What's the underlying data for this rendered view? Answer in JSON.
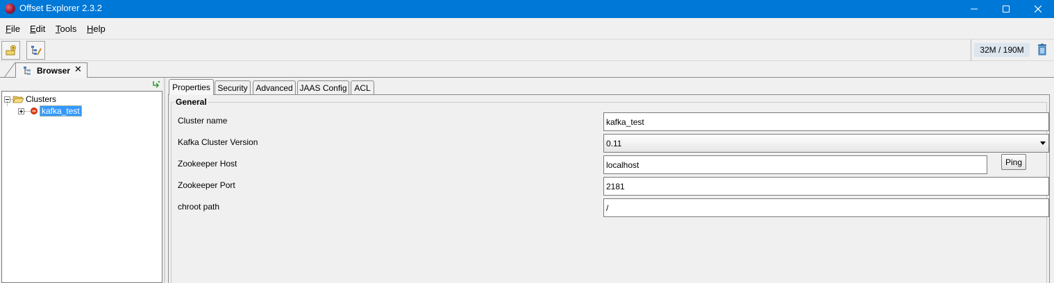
{
  "window": {
    "title": "Offset Explorer  2.3.2",
    "controls": {
      "minimize": "─",
      "maximize": "☐",
      "close": "✕"
    }
  },
  "menu": [
    {
      "label": "File",
      "mnemonic": "F",
      "rest": "ile"
    },
    {
      "label": "Edit",
      "mnemonic": "E",
      "rest": "dit"
    },
    {
      "label": "Tools",
      "mnemonic": "T",
      "rest": "ools"
    },
    {
      "label": "Help",
      "mnemonic": "H",
      "rest": "elp"
    }
  ],
  "toolbar": {
    "buttons": [
      {
        "icon": "add-connection-icon"
      },
      {
        "icon": "edit-connection-icon"
      }
    ],
    "memory": "32M / 190M",
    "trash_icon": "trash-icon"
  },
  "doc_tab": {
    "label": "Browser",
    "close": "✕"
  },
  "tree": {
    "root": {
      "label": "Clusters",
      "expanded": true
    },
    "children": [
      {
        "label": "kafka_test",
        "selected": true,
        "status_color": "#e8451e"
      }
    ]
  },
  "tabs": [
    {
      "label": "Properties",
      "active": true
    },
    {
      "label": "Security",
      "active": false
    },
    {
      "label": "Advanced",
      "active": false
    },
    {
      "label": "JAAS Config",
      "active": false
    },
    {
      "label": "ACL",
      "active": false
    }
  ],
  "general": {
    "title": "General",
    "fields": {
      "cluster_name": {
        "label": "Cluster name",
        "value": "kafka_test"
      },
      "kafka_version": {
        "label": "Kafka Cluster Version",
        "value": "0.11"
      },
      "zk_host": {
        "label": "Zookeeper Host",
        "value": "localhost"
      },
      "zk_port": {
        "label": "Zookeeper Port",
        "value": "2181"
      },
      "chroot": {
        "label": "chroot path",
        "value": "/"
      }
    },
    "ping_label": "Ping"
  },
  "colors": {
    "titlebar": "#0078d7",
    "selection": "#3399ff",
    "background": "#f0f0f0"
  }
}
